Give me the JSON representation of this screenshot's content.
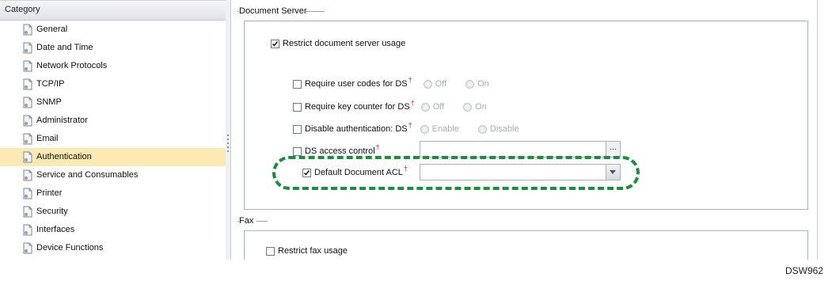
{
  "sidebar": {
    "header": "Category",
    "items": [
      {
        "label": "General",
        "selected": false
      },
      {
        "label": "Date and Time",
        "selected": false
      },
      {
        "label": "Network Protocols",
        "selected": false
      },
      {
        "label": "TCP/IP",
        "selected": false
      },
      {
        "label": "SNMP",
        "selected": false
      },
      {
        "label": "Administrator",
        "selected": false
      },
      {
        "label": "Email",
        "selected": false
      },
      {
        "label": "Authentication",
        "selected": true
      },
      {
        "label": "Service and Consumables",
        "selected": false
      },
      {
        "label": "Printer",
        "selected": false
      },
      {
        "label": "Security",
        "selected": false
      },
      {
        "label": "Interfaces",
        "selected": false
      },
      {
        "label": "Device Functions",
        "selected": false
      }
    ],
    "selected_color": "#fde9b4",
    "icon": "document-icon"
  },
  "document_server": {
    "legend": "Document Server",
    "restrict": {
      "label": "Restrict document server usage",
      "checked": true
    },
    "require_user_codes": {
      "label": "Require user codes for DS",
      "dagger": "†",
      "checked": false,
      "options": [
        "Off",
        "On"
      ]
    },
    "require_key_counter": {
      "label": "Require key counter for DS",
      "dagger": "†",
      "checked": false,
      "options": [
        "Off",
        "On"
      ]
    },
    "disable_auth": {
      "label": "Disable authentication: DS",
      "dagger": "†",
      "checked": false,
      "options": [
        "Enable",
        "Disable"
      ]
    },
    "ds_access_control": {
      "label": "DS access control",
      "dagger": "†",
      "checked": false,
      "value": ""
    },
    "default_acl": {
      "label": "Default Document ACL",
      "dagger": "†",
      "checked": true,
      "value": ""
    }
  },
  "fax": {
    "legend": "Fax",
    "restrict": {
      "label": "Restrict fax usage",
      "checked": false
    }
  },
  "highlight_color": "#1a8f3a",
  "figure_code": "DSW962"
}
